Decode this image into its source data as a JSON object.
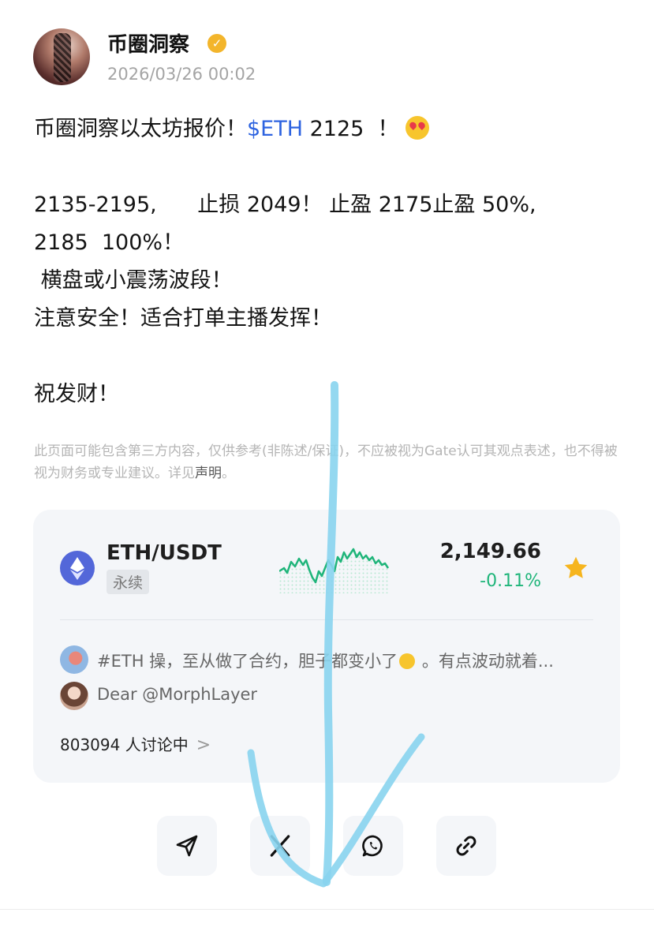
{
  "post": {
    "author": "币圈洞察",
    "time": "2026/03/26 00:02",
    "lines": {
      "l1_prefix": "币圈洞察以太坊报价！",
      "l1_ticker": "$ETH",
      "l1_suffix": " 2125  ！ ",
      "l2": "2135-2195,      止损 2049！ 止盈 2175止盈 50%,",
      "l3": "2185  100%！",
      "l4": " 横盘或小震荡波段！",
      "l5": "注意安全！适合打单主播发挥！",
      "l6": "祝发财！"
    }
  },
  "disclaimer": {
    "text": "此页面可能包含第三方内容，仅供参考(非陈述/保证)，不应被视为Gate认可其观点表述，也不得被视为财务或专业建议。详见",
    "link": "声明",
    "end": "。"
  },
  "card": {
    "pair": "ETH/USDT",
    "badge": "永续",
    "price": "2,149.66",
    "change": "-0.11%",
    "comment1": "#ETH 操，至从做了合约，胆子都变小了",
    "comment1_tail": " 。有点波动就着...",
    "comment2": "Dear @MorphLayer",
    "discuss": "803094 人讨论中",
    "discuss_chevron": ">"
  },
  "colors": {
    "accent_blue": "#2d63e0",
    "positive_green": "#1fb57a",
    "star_yellow": "#f6b51e",
    "eth_purple": "#5367d9",
    "overlay_arrow": "#88d4ee"
  },
  "share": {
    "icons": [
      "send-icon",
      "x-logo-icon",
      "whatsapp-icon",
      "link-icon"
    ]
  }
}
